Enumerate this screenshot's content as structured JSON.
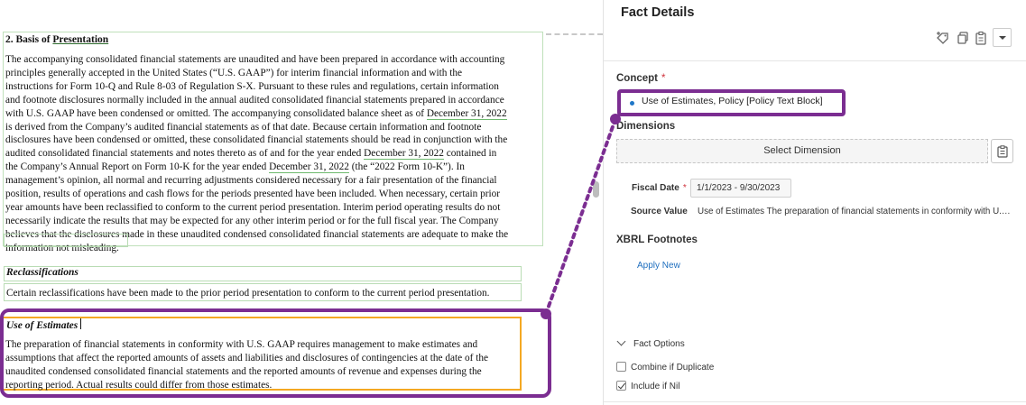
{
  "document": {
    "heading_num": "2. Basis of ",
    "heading_word": "Presentation",
    "basis_lines": [
      [
        {
          "t": "The accompanying consolidated financial statements are unaudited and have been prepared in accordance with accounting"
        }
      ],
      [
        {
          "t": "principles generally accepted in the United States (“U.S. GAAP”) for interim financial information and with the"
        }
      ],
      [
        {
          "t": "instructions for Form 10-Q and Rule 8-03 of Regulation S-X. Pursuant to these rules and regulations, certain information"
        }
      ],
      [
        {
          "t": "and footnote disclosures normally included in the annual audited consolidated financial statements prepared in accordance"
        }
      ],
      [
        {
          "t": "with U.S. GAAP have been condensed or omitted. The accompanying consolidated balance sheet as of "
        },
        {
          "t": "December 31, 2022",
          "u": true
        }
      ],
      [
        {
          "t": "is derived from the Company’s audited financial statements as of that date. Because certain information and footnote"
        }
      ],
      [
        {
          "t": "disclosures have been condensed or omitted, these consolidated financial statements should be read in conjunction with the"
        }
      ],
      [
        {
          "t": "audited consolidated financial statements and notes thereto as of and for the year ended "
        },
        {
          "t": "December 31, 2022",
          "u": true
        },
        {
          "t": " contained in"
        }
      ],
      [
        {
          "t": "the Company’s Annual Report on Form 10-K for the year ended "
        },
        {
          "t": "December 31, 2022",
          "u": true
        },
        {
          "t": " (the “2022 Form 10-K”). In"
        }
      ],
      [
        {
          "t": "management’s opinion, all normal and recurring adjustments considered necessary for a fair presentation of the financial"
        }
      ],
      [
        {
          "t": "position, results of operations and cash flows for the periods presented have been included. When necessary, certain prior"
        }
      ],
      [
        {
          "t": "year amounts have been reclassified to conform to the current period presentation. Interim period operating results do not"
        }
      ],
      [
        {
          "t": "necessarily indicate the results that may be expected for any other interim period or for the full fiscal year. The Company"
        }
      ],
      [
        {
          "t": "believes that the disclosures made in these unaudited condensed consolidated financial statements are adequate to make the"
        }
      ],
      [
        {
          "t": "information not misleading."
        }
      ]
    ],
    "reclass_title": "Reclassifications",
    "reclass_text": "Certain reclassifications have been made to the prior period presentation to conform to the current period presentation.",
    "estimates_title": "Use of Estimates",
    "estimates_lines": [
      "The preparation of financial statements in conformity with U.S. GAAP requires management to make estimates and",
      "assumptions that affect the reported amounts of assets and liabilities and disclosures of contingencies at the date of the",
      "unaudited condensed consolidated financial statements and the reported amounts of revenue and expenses during the",
      "reporting period. Actual results could differ from those estimates."
    ]
  },
  "panel": {
    "title": "Fact Details",
    "concept_label": "Concept",
    "required_mark": "*",
    "concept_value": "Use of Estimates, Policy [Policy Text Block]",
    "dimensions_label": "Dimensions",
    "select_dimension": "Select Dimension",
    "fiscal_date_label": "Fiscal Date",
    "fiscal_date_value": "1/1/2023 - 9/30/2023",
    "source_value_label": "Source Value",
    "source_value": "Use of Estimates The preparation of financial statements in conformity with U.S. GAAP requires management to make estimates",
    "xbrl_footnotes_label": "XBRL Footnotes",
    "apply_new": "Apply New",
    "fact_options_label": "Fact Options",
    "combine_if_duplicate": "Combine if Duplicate",
    "include_if_nil": "Include if Nil",
    "combine_checked": false,
    "include_checked": true
  },
  "colors": {
    "accent_purple": "#7b2d91",
    "selection_orange": "#f4a823",
    "tagged_green": "#b9dcb4",
    "link_blue": "#1f6fbf"
  },
  "icons": [
    "tag-add-icon",
    "copy-icon",
    "clipboard-icon",
    "dropdown-icon",
    "chevron-down-icon"
  ]
}
